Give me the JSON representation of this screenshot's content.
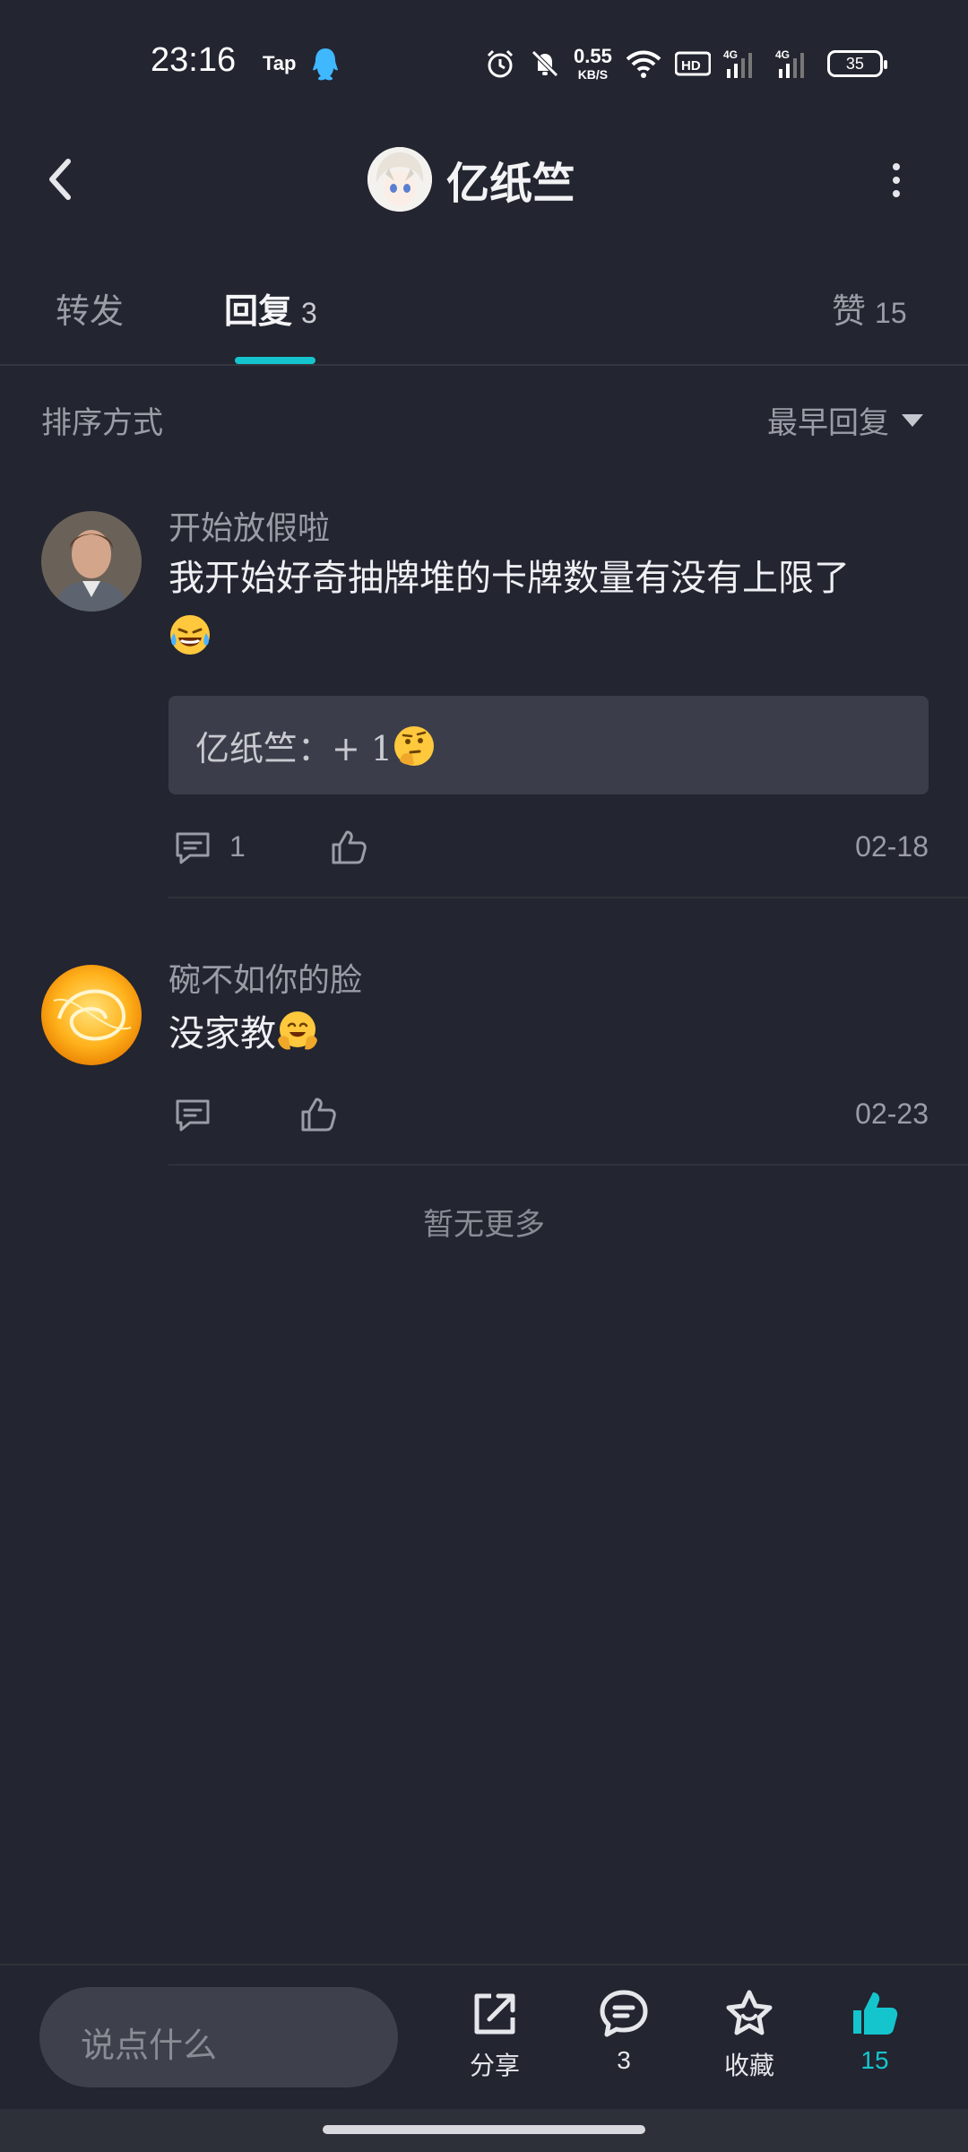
{
  "status_bar": {
    "time": "23:16",
    "app_tag": "Tap",
    "net_speed_value": "0.55",
    "net_speed_unit": "KB/S",
    "battery": "35"
  },
  "header": {
    "title": "亿纸竺",
    "back_icon": "chevron-left-icon",
    "more_icon": "more-vertical-icon"
  },
  "tabs": [
    {
      "label": "转发",
      "count": ""
    },
    {
      "label": "回复",
      "count": "3",
      "active": true
    },
    {
      "label": "赞",
      "count": "15"
    }
  ],
  "sort": {
    "label": "排序方式",
    "value": "最早回复"
  },
  "comments": [
    {
      "author": "开始放假啦",
      "text_line1": "我开始好奇抽牌堆的卡牌数量有没有上限了",
      "emoji": "laughing-crying-emoji",
      "reply_preview": "亿纸竺：+ 1",
      "reply_emoji": "thinking-emoji",
      "reply_count": "1",
      "date": "02-18"
    },
    {
      "author": "碗不如你的脸",
      "text": "没家教",
      "emoji": "hugging-emoji",
      "reply_count": "",
      "date": "02-23"
    }
  ],
  "footer_note": "暂无更多",
  "bottom_bar": {
    "input_placeholder": "说点什么",
    "share_label": "分享",
    "comment_count": "3",
    "favorite_label": "收藏",
    "like_count": "15"
  },
  "colors": {
    "background": "#232530",
    "accent": "#15c5ce",
    "reply_box": "#3b3e4a"
  }
}
